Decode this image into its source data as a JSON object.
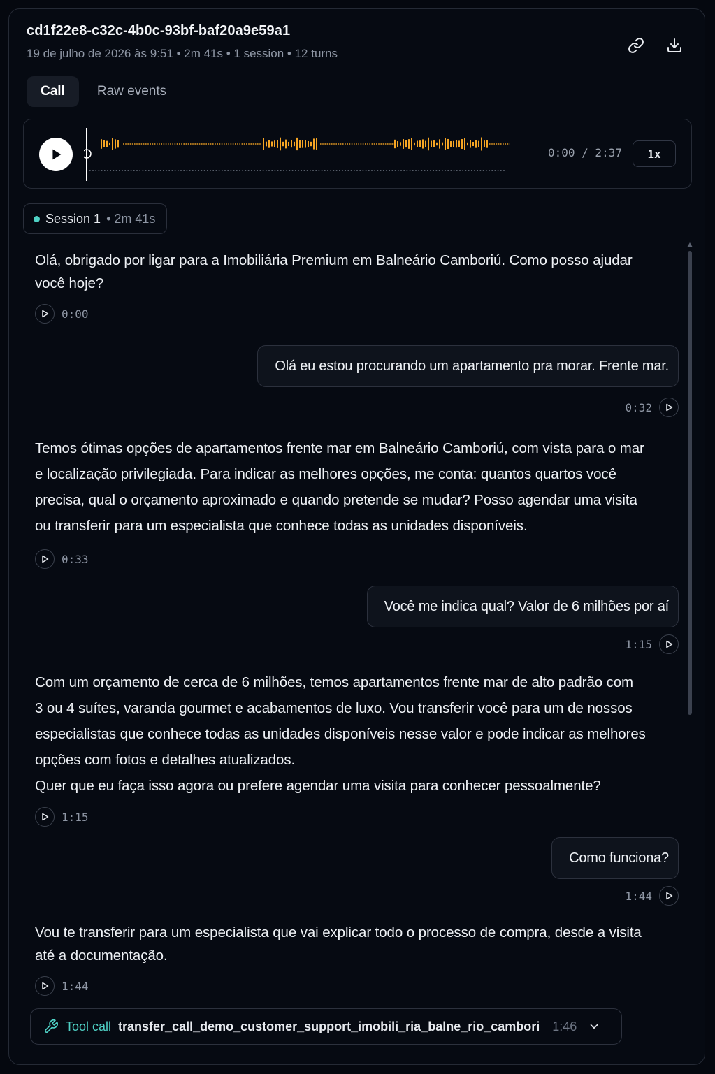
{
  "header": {
    "title": "cd1f22e8-c32c-4b0c-93bf-baf20a9e59a1",
    "meta": "19 de julho de 2026 às 9:51 • 2m 41s • 1 session • 12 turns",
    "copy_link_icon": "link-icon",
    "download_icon": "download-icon"
  },
  "tabs": [
    {
      "label": "Call",
      "active": true
    },
    {
      "label": "Raw events",
      "active": false
    }
  ],
  "player": {
    "time": "0:00 / 2:37",
    "speed": "1x",
    "progress": 0,
    "wave_color": "#f5a524"
  },
  "session": {
    "label": "Session 1",
    "duration": "• 2m 41s",
    "status_color": "#4fd1c5"
  },
  "turns": [
    {
      "role": "agent",
      "lines": [
        "Olá, obrigado por ligar para a Imobiliária Premium em Balneário Camboriú. Como posso ajudar",
        "você hoje?"
      ],
      "time": "0:00"
    },
    {
      "role": "user",
      "text": "Olá eu estou procurando um apartamento pra morar. Frente mar.",
      "time": "0:32"
    },
    {
      "role": "agent",
      "lines": [
        "Temos ótimas opções de apartamentos frente mar em Balneário Camboriú, com vista para o mar",
        "e localização privilegiada. Para indicar as melhores opções, me conta: quantos quartos você",
        "precisa, qual o orçamento aproximado e quando pretende se mudar? Posso agendar uma visita",
        "ou transferir para um especialista que conhece todas as unidades disponíveis."
      ],
      "time": "0:33"
    },
    {
      "role": "user",
      "text": "Você me indica qual? Valor de 6 milhões por aí",
      "time": "1:15"
    },
    {
      "role": "agent",
      "lines": [
        "Com um orçamento de cerca de 6 milhões, temos apartamentos frente mar de alto padrão com",
        "3 ou 4 suítes, varanda gourmet e acabamentos de luxo. Vou transferir você para um de nossos",
        "especialistas que conhece todas as unidades disponíveis nesse valor e pode indicar as melhores",
        "opções com fotos e detalhes atualizados.",
        "Quer que eu faça isso agora ou prefere agendar uma visita para conhecer pessoalmente?"
      ],
      "time": "1:15"
    },
    {
      "role": "user",
      "text": "Como funciona?",
      "time": "1:44"
    },
    {
      "role": "agent",
      "lines": [
        "Vou te transferir para um especialista que vai explicar todo o processo de compra, desde a visita",
        "até a documentação."
      ],
      "time": "1:44"
    }
  ],
  "tool_call": {
    "label": "Tool call",
    "name": "transfer_call_demo_customer_support_imobili_ria_balne_rio_cambori",
    "time": "1:46",
    "icon": "wrench-icon",
    "accent": "#4fd1c5"
  }
}
